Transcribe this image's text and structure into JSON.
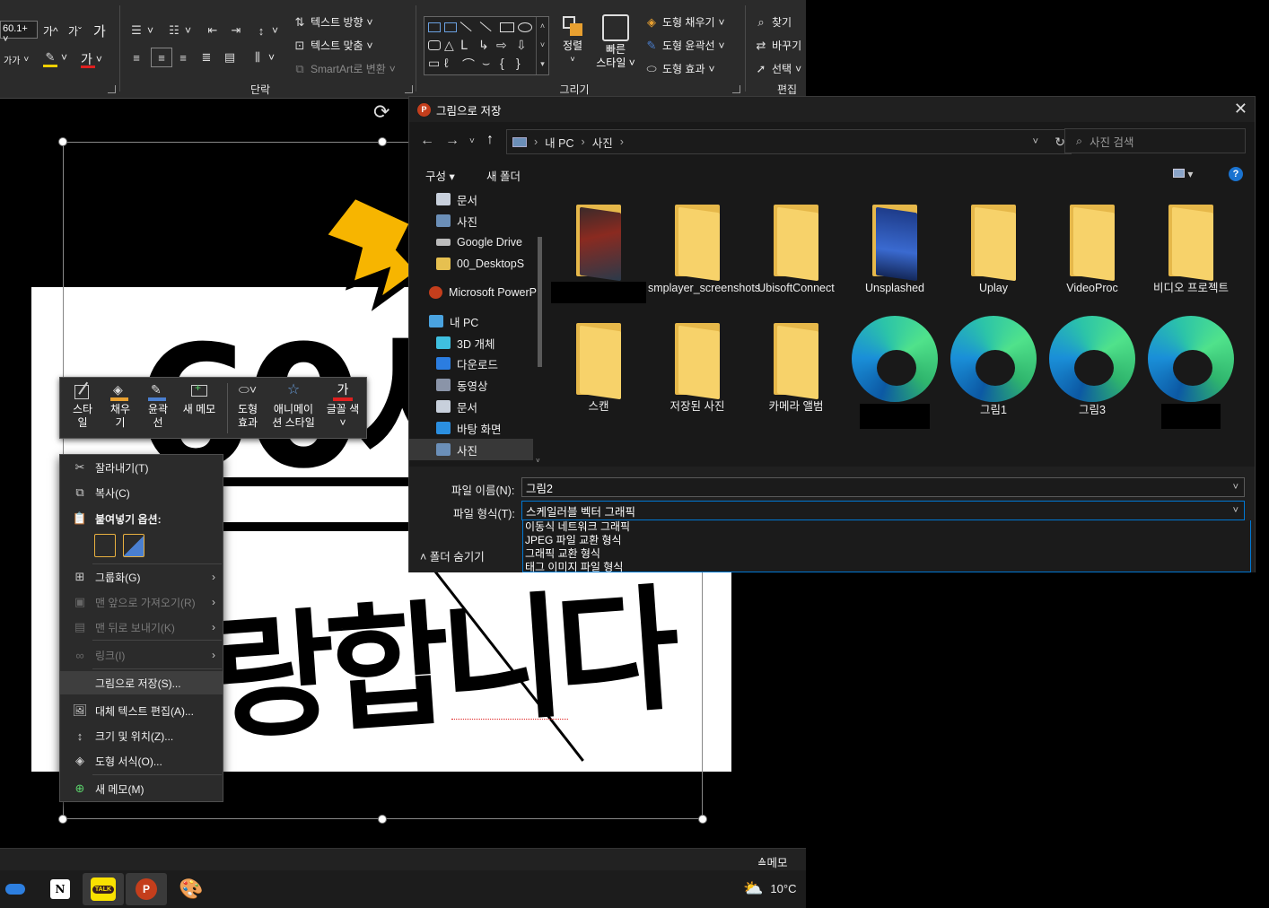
{
  "ribbon": {
    "font_size": "60.1+",
    "grow_font": "가^",
    "shrink_font": "가ˇ",
    "clear_format": "가",
    "font_small": "가가",
    "font_color_glyph": "가",
    "text_direction": "텍스트 방향",
    "align_text": "텍스트 맞춤",
    "smartart": "SmartArt로 변환",
    "arrange": "정렬",
    "quick_styles_1": "빠른",
    "quick_styles_2": "스타일",
    "shape_fill": "도형 채우기",
    "shape_outline": "도형 윤곽선",
    "shape_effects": "도형 효과",
    "find": "찾기",
    "replace": "바꾸기",
    "select": "선택",
    "group_paragraph": "단락",
    "group_drawing": "그리기",
    "group_editing": "편집",
    "colors": {
      "highlight": "#f0d000",
      "font_color": "#e02020"
    }
  },
  "slide": {
    "text_top": "60세",
    "text_bottom": "랑합니다"
  },
  "mini_toolbar": {
    "style": [
      "스타",
      "일"
    ],
    "fill": [
      "채우",
      "기"
    ],
    "outline": [
      "윤곽",
      "선"
    ],
    "new_memo": "새 메모",
    "shape_effects": [
      "도형",
      "효과"
    ],
    "animation_style": [
      "애니메이",
      "션 스타일"
    ],
    "font_color": "글꼴 색",
    "font_glyph": "가",
    "colors": {
      "fill": "#e8a030",
      "outline": "#4a7fd0",
      "font": "#e02020"
    }
  },
  "context_menu": {
    "cut": "잘라내기(T)",
    "copy": "복사(C)",
    "paste_options": "붙여넣기 옵션:",
    "group": "그룹화(G)",
    "bring_front": "맨 앞으로 가져오기(R)",
    "send_back": "맨 뒤로 보내기(K)",
    "link": "링크(I)",
    "save_as_picture": "그림으로 저장(S)...",
    "edit_alt_text": "대체 텍스트 편집(A)...",
    "size_position": "크기 및 위치(Z)...",
    "format_shape": "도형 서식(O)...",
    "new_memo": "새 메모(M)"
  },
  "status_bar": {
    "memo": "메모"
  },
  "taskbar": {
    "apps": [
      "bluetooth-app",
      "notion",
      "kakaotalk",
      "powerpoint",
      "paint"
    ],
    "kakao_label": "TALK",
    "temperature": "10°C"
  },
  "dialog": {
    "title": "그림으로 저장",
    "breadcrumb": [
      "내 PC",
      "사진"
    ],
    "search_placeholder": "사진 검색",
    "organize": "구성",
    "new_folder": "새 폴더",
    "nav": [
      {
        "label": "문서",
        "pinned": true
      },
      {
        "label": "사진",
        "pinned": true
      },
      {
        "label": "Google Drive",
        "pinned": true
      },
      {
        "label": "00_DesktopS",
        "pinned": true
      },
      {
        "label": "Microsoft PowerP",
        "pinned": false
      },
      {
        "label": "내 PC",
        "pinned": false
      },
      {
        "label": "3D 개체",
        "pinned": false
      },
      {
        "label": "다운로드",
        "pinned": false
      },
      {
        "label": "동영상",
        "pinned": false
      },
      {
        "label": "문서",
        "pinned": false
      },
      {
        "label": "바탕 화면",
        "pinned": false
      },
      {
        "label": "사진",
        "pinned": false
      }
    ],
    "files": [
      {
        "label": "",
        "kind": "folder-photo"
      },
      {
        "label": "smplayer_screenshots",
        "kind": "folder"
      },
      {
        "label": "UbisoftConnect",
        "kind": "folder"
      },
      {
        "label": "Unsplashed",
        "kind": "folder-blue"
      },
      {
        "label": "Uplay",
        "kind": "folder"
      },
      {
        "label": "VideoProc",
        "kind": "folder"
      },
      {
        "label": "비디오 프로젝트",
        "kind": "folder"
      },
      {
        "label": "스캔",
        "kind": "folder"
      },
      {
        "label": "저장된 사진",
        "kind": "folder"
      },
      {
        "label": "카메라 앨범",
        "kind": "folder"
      },
      {
        "label": "",
        "kind": "edge"
      },
      {
        "label": "그림1",
        "kind": "edge"
      },
      {
        "label": "그림3",
        "kind": "edge"
      },
      {
        "label": "",
        "kind": "edge"
      }
    ],
    "filename_label": "파일 이름(N):",
    "filename_value": "그림2",
    "filetype_label": "파일 형식(T):",
    "filetype_value": "스케일러블 벡터 그래픽",
    "filetype_options": [
      "이동식 네트워크 그래픽",
      "JPEG 파일 교환 형식",
      "그래픽 교환 형식",
      "태그 이미지 파일 형식"
    ],
    "hide_folders": "폴더 숨기기"
  }
}
